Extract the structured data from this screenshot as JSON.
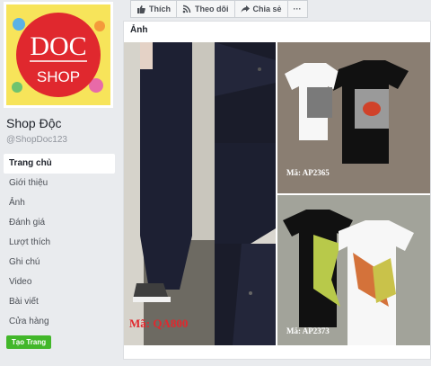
{
  "page": {
    "name": "Shop Độc",
    "handle": "@ShopDoc123",
    "logo_top": "DOC",
    "logo_bottom": "SHOP"
  },
  "nav": {
    "items": [
      {
        "label": "Trang chủ",
        "active": true
      },
      {
        "label": "Giới thiệu"
      },
      {
        "label": "Ảnh"
      },
      {
        "label": "Đánh giá"
      },
      {
        "label": "Lượt thích"
      },
      {
        "label": "Ghi chú"
      },
      {
        "label": "Video"
      },
      {
        "label": "Bài viết"
      },
      {
        "label": "Cửa hàng"
      }
    ],
    "create_page": "Tạo Trang"
  },
  "actions": {
    "like": "Thích",
    "follow": "Theo dõi",
    "share": "Chia sẻ",
    "more": "···"
  },
  "photos": {
    "title": "Ảnh",
    "codes": [
      "Mã: QA800",
      "Mã: AP2365",
      "Mã: AP2373"
    ]
  },
  "colors": {
    "brand_red": "#e0282e",
    "logo_bg": "#f7e45a",
    "green": "#42b72a"
  }
}
